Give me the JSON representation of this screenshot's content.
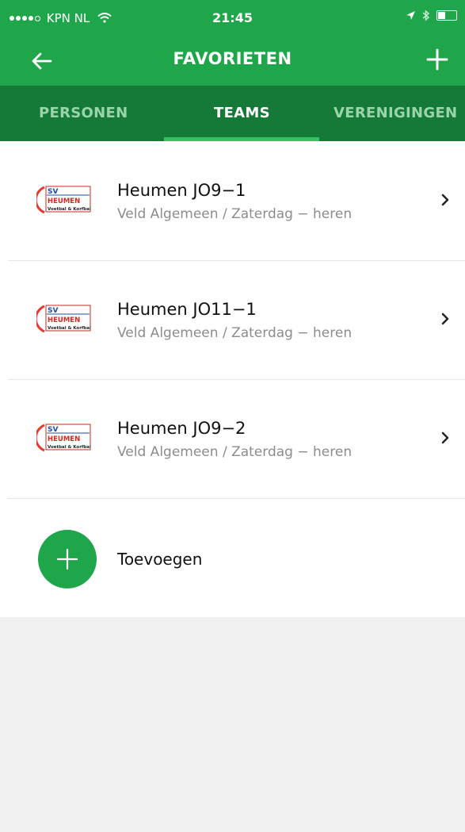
{
  "status_bar": {
    "carrier": "KPN NL",
    "time": "21:45"
  },
  "header": {
    "title": "FAVORIETEN"
  },
  "tabs": [
    {
      "label": "PERSONEN",
      "active": false
    },
    {
      "label": "TEAMS",
      "active": true
    },
    {
      "label": "VERENIGINGEN",
      "active": false
    }
  ],
  "teams": [
    {
      "name": "Heumen JO9−1",
      "subtitle": "Veld Algemeen / Zaterdag − heren"
    },
    {
      "name": "Heumen JO11−1",
      "subtitle": "Veld Algemeen / Zaterdag − heren"
    },
    {
      "name": "Heumen JO9−2",
      "subtitle": "Veld Algemeen / Zaterdag − heren"
    }
  ],
  "add_button": {
    "label": "Toevoegen"
  },
  "colors": {
    "primary": "#1fa64a",
    "tab_bar": "#157a37",
    "tab_indicator": "#30c464"
  },
  "icons": {
    "back": "arrow-left-icon",
    "add": "plus-icon",
    "chevron": "chevron-right-icon",
    "team_logo": "sv-heumen-logo"
  },
  "logo_text": {
    "top": "SV",
    "middle": "HEUMEN",
    "bottom": "Voetbal & Korfbal"
  }
}
